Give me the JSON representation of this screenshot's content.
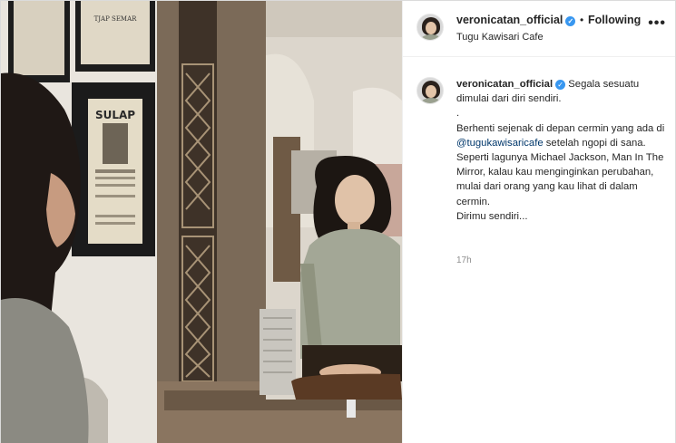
{
  "photo": {
    "description_icon": "mirror-photo"
  },
  "header": {
    "username": "veronicatan_official",
    "verified": "✓",
    "separator": "•",
    "follow_label": "Following",
    "location": "Tugu Kawisari Cafe",
    "more_icon": "•••"
  },
  "caption": {
    "username": "veronicatan_official",
    "verified": "✓",
    "line1": "Segala sesuatu dimulai dari diri sendiri.",
    "line2": ".",
    "line3_pre": "Berhenti sejenak di depan cermin yang ada di ",
    "mention": "@tugukawisaricafe",
    "line3_post": " setelah ngopi di sana.",
    "line4": "Seperti lagunya Michael Jackson, Man In The Mirror, kalau kau menginginkan perubahan, mulai dari orang yang kau lihat di dalam cermin.",
    "line5": "Dirimu sendiri...",
    "time": "17h"
  },
  "poster": {
    "sulap_title": "SULAP",
    "tjap_semar": "TJAP SEMAR"
  },
  "colors": {
    "verified": "#3897f0",
    "mention": "#00376b",
    "muted": "#8e8e8e"
  }
}
